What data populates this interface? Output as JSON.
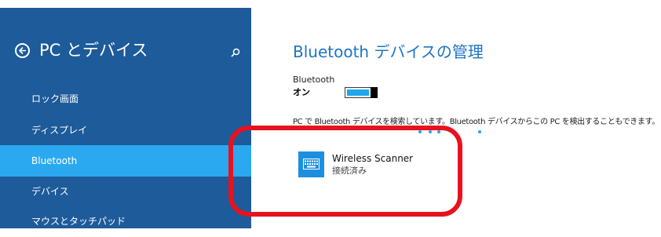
{
  "sidebar": {
    "title": "PC とデバイス",
    "items": [
      {
        "label": "ロック画面",
        "selected": false
      },
      {
        "label": "ディスプレイ",
        "selected": false
      },
      {
        "label": "Bluetooth",
        "selected": true
      },
      {
        "label": "デバイス",
        "selected": false
      },
      {
        "label": "マウスとタッチパッド",
        "selected": false
      }
    ]
  },
  "main": {
    "title": "Bluetooth デバイスの管理",
    "toggle_label": "Bluetooth",
    "toggle_state": "オン",
    "status_text": "PC で Bluetooth デバイスを検索しています。Bluetooth デバイスからこの PC を検出することもできます。",
    "device": {
      "name": "Wireless Scanner",
      "status": "接続済み",
      "icon": "keyboard-icon"
    }
  },
  "icons": {
    "back": "back-arrow-icon",
    "search": "search-icon"
  },
  "colors": {
    "sidebar_bg": "#1d5b9a",
    "selected_bg": "#2aa9f0",
    "accent": "#1c74c6",
    "toggle_fill": "#1ea6ef",
    "annotation_red": "#e8121e"
  }
}
